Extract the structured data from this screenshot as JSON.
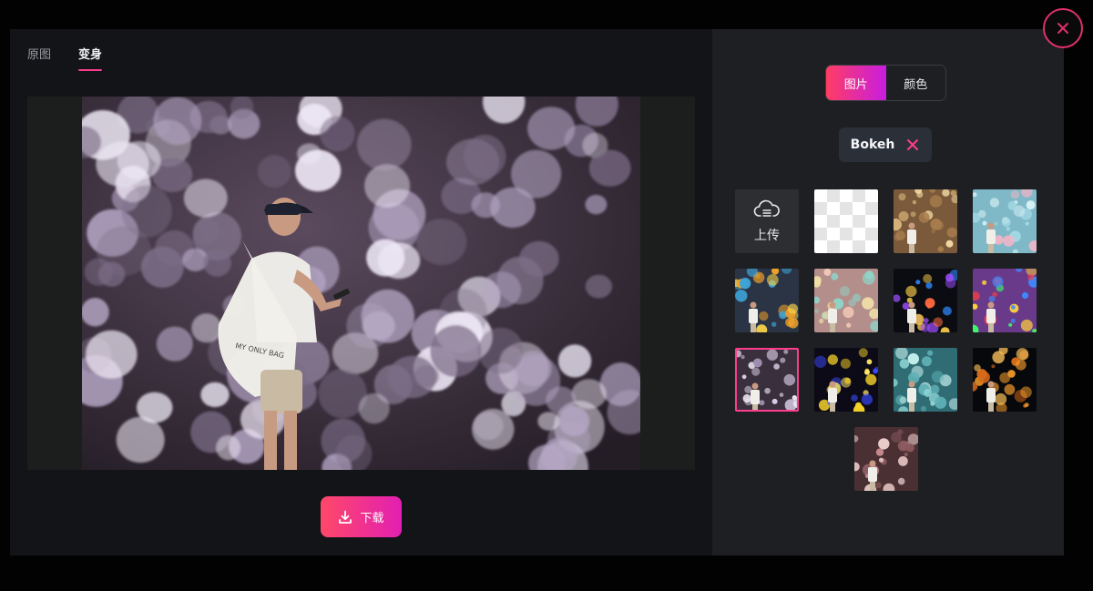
{
  "tabs": [
    {
      "label": "原图",
      "active": false
    },
    {
      "label": "变身",
      "active": true
    }
  ],
  "download": {
    "label": "下载",
    "icon": "download-icon"
  },
  "source_toggle": [
    {
      "label": "图片",
      "active": true
    },
    {
      "label": "颜色",
      "active": false
    }
  ],
  "selected_background": {
    "label": "Bokeh",
    "clear_icon": "x-icon"
  },
  "upload": {
    "label": "上传",
    "icon": "cloud-upload-icon"
  },
  "backgrounds": [
    {
      "name": "transparent"
    },
    {
      "name": "golden-glitter"
    },
    {
      "name": "cyan-bokeh"
    },
    {
      "name": "blue-orange-bokeh"
    },
    {
      "name": "pastel-bokeh"
    },
    {
      "name": "dark-color-bokeh"
    },
    {
      "name": "rainbow-glitter"
    },
    {
      "name": "purple-bokeh",
      "selected": true
    },
    {
      "name": "night-yellow-lights"
    },
    {
      "name": "teal-bokeh"
    },
    {
      "name": "night-orange-lights"
    },
    {
      "name": "rose-sparkle"
    }
  ],
  "close": {
    "icon": "close-icon"
  },
  "colors": {
    "accent": "#ff3c8e",
    "gradient_start": "#ff4868",
    "gradient_end": "#e21fb2",
    "panel": "#1e1f22",
    "modal": "#131417"
  }
}
